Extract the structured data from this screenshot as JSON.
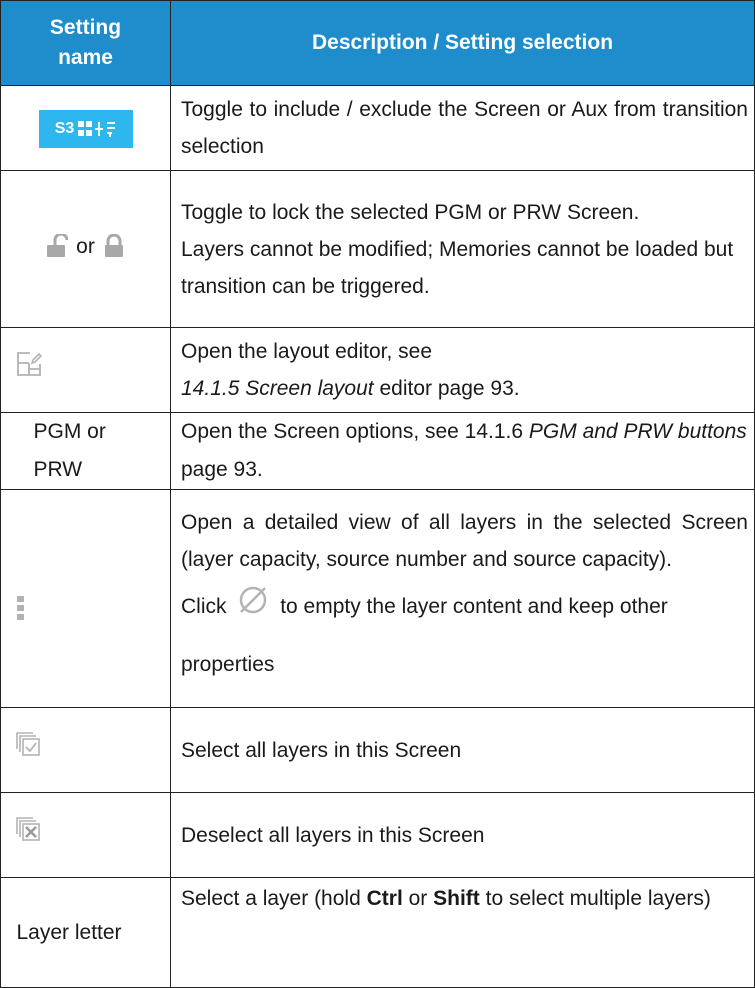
{
  "header": {
    "col1": "Setting name",
    "col2": "Description / Setting selection"
  },
  "rows": {
    "transition": {
      "icon_text": "S3",
      "desc": "Toggle to include / exclude the Screen or Aux from transition selection"
    },
    "lock": {
      "or": "or",
      "desc1": "Toggle to lock the selected PGM or PRW Screen.",
      "desc2": "Layers cannot be modified; Memories cannot be loaded but transition can be triggered."
    },
    "layout": {
      "desc1": "Open the layout editor, see",
      "ref_italic": "14.1.5 Screen layout",
      "ref_rest": " editor page 93."
    },
    "pgm": {
      "name": "PGM or PRW",
      "desc_a": "Open the Screen options, see 14.1.6 ",
      "desc_italic": "PGM and PRW buttons",
      "desc_b": " page 93."
    },
    "detail": {
      "desc1": "Open a detailed view of all layers in the selected Screen (layer capacity, source number and source capacity).",
      "click": "Click",
      "desc2": "to empty the layer content and keep other properties"
    },
    "select_all": {
      "desc": "Select all layers in this Screen"
    },
    "deselect_all": {
      "desc": "Deselect all layers in this Screen"
    },
    "layer_letter": {
      "name": "Layer letter",
      "desc_a": "Select a layer (hold ",
      "ctrl": "Ctrl",
      "or": " or ",
      "shift": "Shift",
      "desc_b": " to select multiple layers)"
    }
  },
  "icons": [
    "grid-list-icon",
    "unlock-icon",
    "lock-icon",
    "layout-edit-icon",
    "more-vertical-icon",
    "empty-circle-icon",
    "select-all-icon",
    "deselect-all-icon"
  ],
  "colors": {
    "header_bg": "#1f8ccc",
    "s3_badge": "#2eb6ef",
    "icon_gray": "#a8a8a8"
  }
}
